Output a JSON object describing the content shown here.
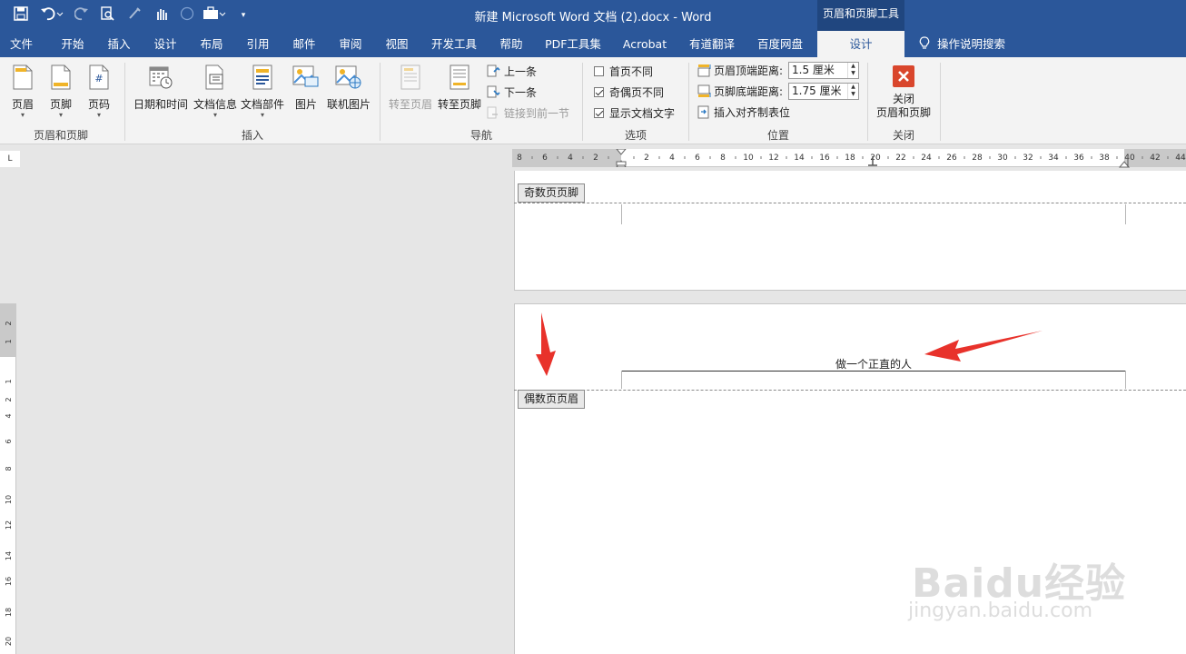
{
  "window": {
    "title": "新建 Microsoft Word 文档 (2).docx  -  Word",
    "context_tools": "页眉和页脚工具"
  },
  "quick_access": [
    "save-icon",
    "undo-icon",
    "redo-icon",
    "print-preview-icon",
    "format-painter-icon",
    "touch-mode-icon",
    "circle-icon",
    "briefcase-icon",
    "customize-icon"
  ],
  "tabs": [
    {
      "label": "文件"
    },
    {
      "label": "开始"
    },
    {
      "label": "插入"
    },
    {
      "label": "设计"
    },
    {
      "label": "布局"
    },
    {
      "label": "引用"
    },
    {
      "label": "邮件"
    },
    {
      "label": "审阅"
    },
    {
      "label": "视图"
    },
    {
      "label": "开发工具"
    },
    {
      "label": "帮助"
    },
    {
      "label": "PDF工具集"
    },
    {
      "label": "Acrobat"
    },
    {
      "label": "有道翻译"
    },
    {
      "label": "百度网盘"
    },
    {
      "label": "设计",
      "active": true
    }
  ],
  "tell_me": "操作说明搜索",
  "ribbon": {
    "group_hf": {
      "label": "页眉和页脚",
      "header": "页眉",
      "footer": "页脚",
      "page_number": "页码"
    },
    "group_insert": {
      "label": "插入",
      "datetime": "日期和时间",
      "docinfo": "文档信息",
      "quickparts": "文档部件",
      "picture": "图片",
      "online_picture": "联机图片"
    },
    "group_nav": {
      "label": "导航",
      "goto_header": "转至页眉",
      "goto_footer": "转至页脚",
      "previous": "上一条",
      "next": "下一条",
      "link_previous": "链接到前一节"
    },
    "group_options": {
      "label": "选项",
      "different_first": "首页不同",
      "different_odd_even": "奇偶页不同",
      "show_doc_text": "显示文档文字"
    },
    "group_position": {
      "label": "位置",
      "header_top_label": "页眉顶端距离:",
      "header_top_value": "1.5 厘米",
      "footer_bottom_label": "页脚底端距离:",
      "footer_bottom_value": "1.75 厘米",
      "insert_align_tab": "插入对齐制表位"
    },
    "group_close": {
      "label": "关闭",
      "close_line1": "关闭",
      "close_line2": "页眉和页脚"
    }
  },
  "ruler": {
    "corner": "L",
    "left_numbers": [
      "8",
      "6",
      "4",
      "2"
    ],
    "right_numbers": [
      "2",
      "4",
      "6",
      "8",
      "10",
      "12",
      "14",
      "16",
      "18",
      "20",
      "22",
      "24",
      "26",
      "28",
      "30",
      "32",
      "34",
      "36",
      "38",
      "40",
      "42",
      "44"
    ],
    "vertical_numbers": [
      "2",
      "1",
      "1",
      "2",
      "4",
      "6",
      "8",
      "10",
      "12",
      "14",
      "16",
      "18",
      "20"
    ]
  },
  "document": {
    "odd_footer_tag": "奇数页页脚",
    "even_header_tag": "偶数页页眉",
    "header_text": "做一个正直的人"
  },
  "watermark": {
    "logo": "Baidu经验",
    "url": "jingyan.baidu.com"
  },
  "colors": {
    "titlebar": "#2b579a",
    "arrow": "#e8322b",
    "close_button": "#d9462c"
  },
  "options_state": {
    "different_first": false,
    "different_odd_even": true,
    "show_doc_text": true
  }
}
